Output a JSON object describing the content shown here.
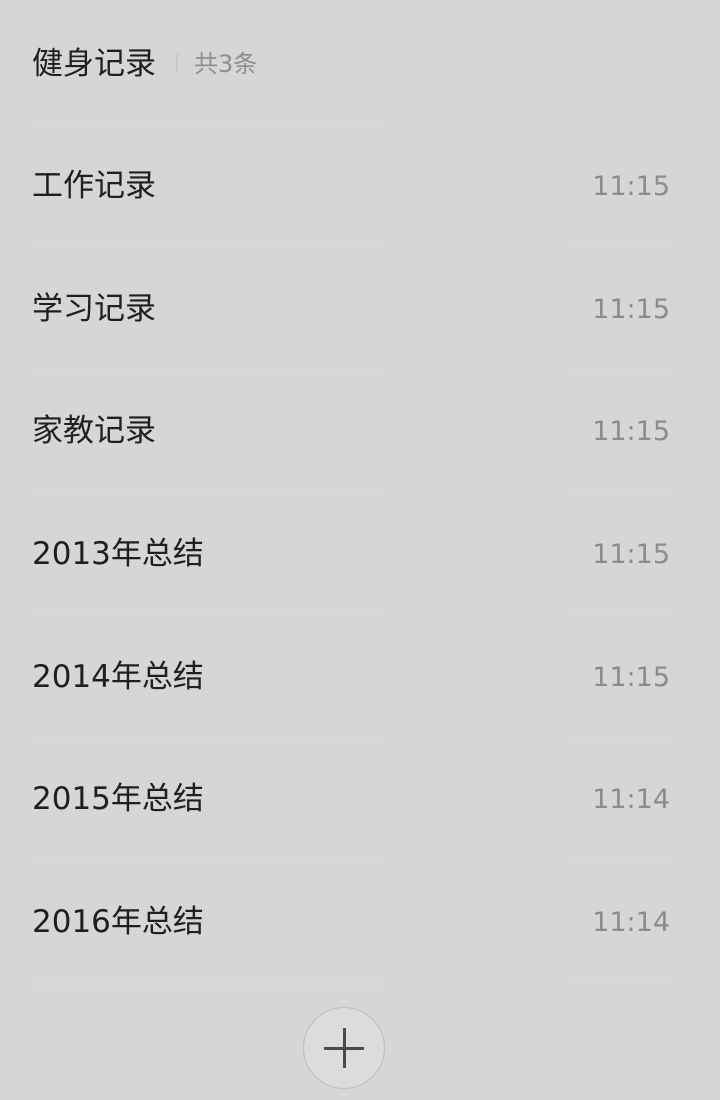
{
  "header": {
    "title": "健身记录",
    "count": "共3条"
  },
  "notes": [
    {
      "title": "工作记录",
      "time": "11:15"
    },
    {
      "title": "学习记录",
      "time": "11:15"
    },
    {
      "title": "家教记录",
      "time": "11:15"
    },
    {
      "title": "2013年总结",
      "time": "11:15"
    },
    {
      "title": "2014年总结",
      "time": "11:15"
    },
    {
      "title": "2015年总结",
      "time": "11:14"
    },
    {
      "title": "2016年总结",
      "time": "11:14"
    }
  ],
  "fab": {
    "icon": "plus-icon"
  }
}
